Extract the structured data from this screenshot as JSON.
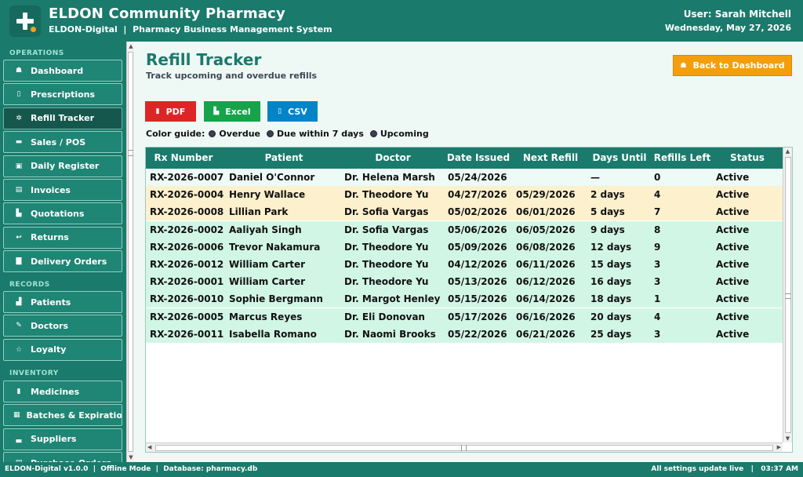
{
  "header": {
    "title": "ELDON Community Pharmacy",
    "subtitle": "ELDON-Digital  |  Pharmacy Business Management System",
    "user": "User: Sarah Mitchell",
    "date": "Wednesday, May 27, 2026"
  },
  "sidebar": {
    "sections": [
      {
        "label": "OPERATIONS",
        "items": [
          {
            "label": "Dashboard",
            "icon": "home-icon",
            "glyph": "☗"
          },
          {
            "label": "Prescriptions",
            "icon": "clipboard-icon",
            "glyph": "▯"
          },
          {
            "label": "Refill Tracker",
            "icon": "gear-icon",
            "glyph": "✲",
            "active": true
          },
          {
            "label": "Sales / POS",
            "icon": "card-icon",
            "glyph": "▬"
          },
          {
            "label": "Daily Register",
            "icon": "register-icon",
            "glyph": "▣"
          },
          {
            "label": "Invoices",
            "icon": "invoice-icon",
            "glyph": "▤"
          },
          {
            "label": "Quotations",
            "icon": "quote-icon",
            "glyph": "▙"
          },
          {
            "label": "Returns",
            "icon": "return-icon",
            "glyph": "↩"
          },
          {
            "label": "Delivery Orders",
            "icon": "truck-icon",
            "glyph": "▇"
          }
        ]
      },
      {
        "label": "RECORDS",
        "items": [
          {
            "label": "Patients",
            "icon": "people-icon",
            "glyph": "▟"
          },
          {
            "label": "Doctors",
            "icon": "stethoscope-icon",
            "glyph": "✎"
          },
          {
            "label": "Loyalty",
            "icon": "star-icon",
            "glyph": "☆"
          }
        ]
      },
      {
        "label": "INVENTORY",
        "items": [
          {
            "label": "Medicines",
            "icon": "pill-icon",
            "glyph": "▮"
          },
          {
            "label": "Batches & Expiration",
            "icon": "box-icon",
            "glyph": "▦"
          },
          {
            "label": "Suppliers",
            "icon": "factory-icon",
            "glyph": "▃"
          },
          {
            "label": "Purchase Orders",
            "icon": "cart-icon",
            "glyph": "▤"
          }
        ]
      }
    ]
  },
  "main": {
    "title": "Refill Tracker",
    "subtitle": "Track upcoming and overdue refills",
    "back_button": "Back to Dashboard",
    "back_icon": "home-icon",
    "export_buttons": [
      {
        "label": "PDF",
        "icon": "pdf-icon",
        "glyph": "▮",
        "color": "#dc2626"
      },
      {
        "label": "Excel",
        "icon": "chart-icon",
        "glyph": "▙",
        "color": "#16a34a"
      },
      {
        "label": "CSV",
        "icon": "file-icon",
        "glyph": "▯",
        "color": "#0284c7"
      }
    ],
    "color_guide": {
      "label": "Color guide:",
      "items": [
        "Overdue",
        "Due within 7 days",
        "Upcoming"
      ]
    },
    "table": {
      "columns": [
        "Rx Number",
        "Patient",
        "Doctor",
        "Date Issued",
        "Next Refill",
        "Days Until",
        "Refills Left",
        "Status"
      ],
      "rows": [
        {
          "cells": [
            "RX-2026-0007",
            "Daniel O'Connor",
            "Dr. Helena Marsh",
            "05/24/2026",
            "",
            "—",
            "0",
            "Active"
          ],
          "bg": "#eefaf6"
        },
        {
          "cells": [
            "RX-2026-0004",
            "Henry Wallace",
            "Dr. Theodore Yu",
            "04/27/2026",
            "05/29/2026",
            "2 days",
            "4",
            "Active"
          ],
          "bg": "#fdf0cc"
        },
        {
          "cells": [
            "RX-2026-0008",
            "Lillian Park",
            "Dr. Sofia Vargas",
            "05/02/2026",
            "06/01/2026",
            "5 days",
            "7",
            "Active"
          ],
          "bg": "#fdf0cc"
        },
        {
          "cells": [
            "RX-2026-0002",
            "Aaliyah Singh",
            "Dr. Sofia Vargas",
            "05/06/2026",
            "06/05/2026",
            "9 days",
            "8",
            "Active"
          ],
          "bg": "#d2f6e6"
        },
        {
          "cells": [
            "RX-2026-0006",
            "Trevor Nakamura",
            "Dr. Theodore Yu",
            "05/09/2026",
            "06/08/2026",
            "12 days",
            "9",
            "Active"
          ],
          "bg": "#d2f6e6"
        },
        {
          "cells": [
            "RX-2026-0012",
            "William Carter",
            "Dr. Theodore Yu",
            "04/12/2026",
            "06/11/2026",
            "15 days",
            "3",
            "Active"
          ],
          "bg": "#d2f6e6"
        },
        {
          "cells": [
            "RX-2026-0001",
            "William Carter",
            "Dr. Theodore Yu",
            "05/13/2026",
            "06/12/2026",
            "16 days",
            "3",
            "Active"
          ],
          "bg": "#d2f6e6"
        },
        {
          "cells": [
            "RX-2026-0010",
            "Sophie Bergmann",
            "Dr. Margot Henley",
            "05/15/2026",
            "06/14/2026",
            "18 days",
            "1",
            "Active"
          ],
          "bg": "#d2f6e6"
        },
        {
          "cells": [
            "RX-2026-0005",
            "Marcus Reyes",
            "Dr. Eli Donovan",
            "05/17/2026",
            "06/16/2026",
            "20 days",
            "4",
            "Active"
          ],
          "bg": "#d2f6e6"
        },
        {
          "cells": [
            "RX-2026-0011",
            "Isabella Romano",
            "Dr. Naomi Brooks",
            "05/22/2026",
            "06/21/2026",
            "25 days",
            "3",
            "Active"
          ],
          "bg": "#d2f6e6"
        }
      ]
    }
  },
  "statusbar": {
    "left": "ELDON-Digital v1.0.0  |  Offline Mode  |  Database: pharmacy.db",
    "right": "All settings update live   |   03:37 AM"
  },
  "colors": {
    "primary": "#1a7a6c",
    "accent": "#f59e0b",
    "row_due_soon": "#fdf0cc",
    "row_upcoming": "#d2f6e6"
  }
}
